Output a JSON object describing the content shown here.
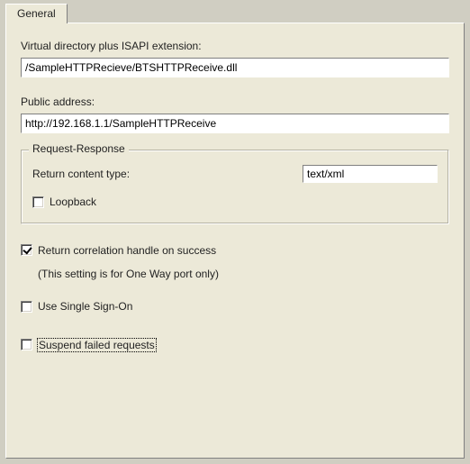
{
  "tab": {
    "general_label": "General"
  },
  "form": {
    "vdir_label": "Virtual directory plus ISAPI extension:",
    "vdir_value": "/SampleHTTPRecieve/BTSHTTPReceive.dll",
    "public_addr_label": "Public address:",
    "public_addr_value": "http://192.168.1.1/SampleHTTPReceive"
  },
  "group_request_response": {
    "title": "Request-Response",
    "return_content_type_label": "Return content type:",
    "return_content_type_value": "text/xml",
    "loopback_label": "Loopback",
    "loopback_checked": false
  },
  "opts": {
    "return_corr_label": "Return correlation handle on success",
    "return_corr_checked": true,
    "return_corr_note": "(This setting is for One Way port only)",
    "use_sso_label": "Use Single Sign-On",
    "use_sso_checked": false,
    "suspend_failed_label": "Suspend failed requests",
    "suspend_failed_checked": false
  }
}
